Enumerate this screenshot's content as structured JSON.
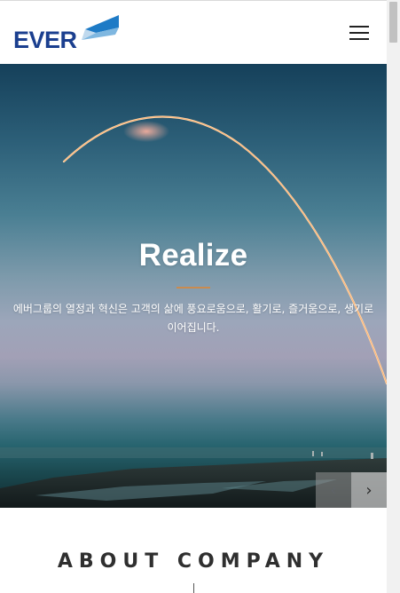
{
  "header": {
    "logo_text": "EVER",
    "menu_icon": "hamburger-menu-icon"
  },
  "hero": {
    "title": "Realize",
    "description": "에버그룹의 열정과 혁신은 고객의 삶에 풍요로움으로, 활기로, 즐거움으로, 생기로 이어집니다.",
    "prev_icon": "chevron-left-icon",
    "next_icon": "chevron-right-icon",
    "prev_glyph": "‹",
    "next_glyph": "›"
  },
  "about": {
    "title": "ABOUT COMPANY"
  },
  "colors": {
    "brand_blue": "#1b3f8f",
    "accent_divider": "#c98b4f"
  }
}
